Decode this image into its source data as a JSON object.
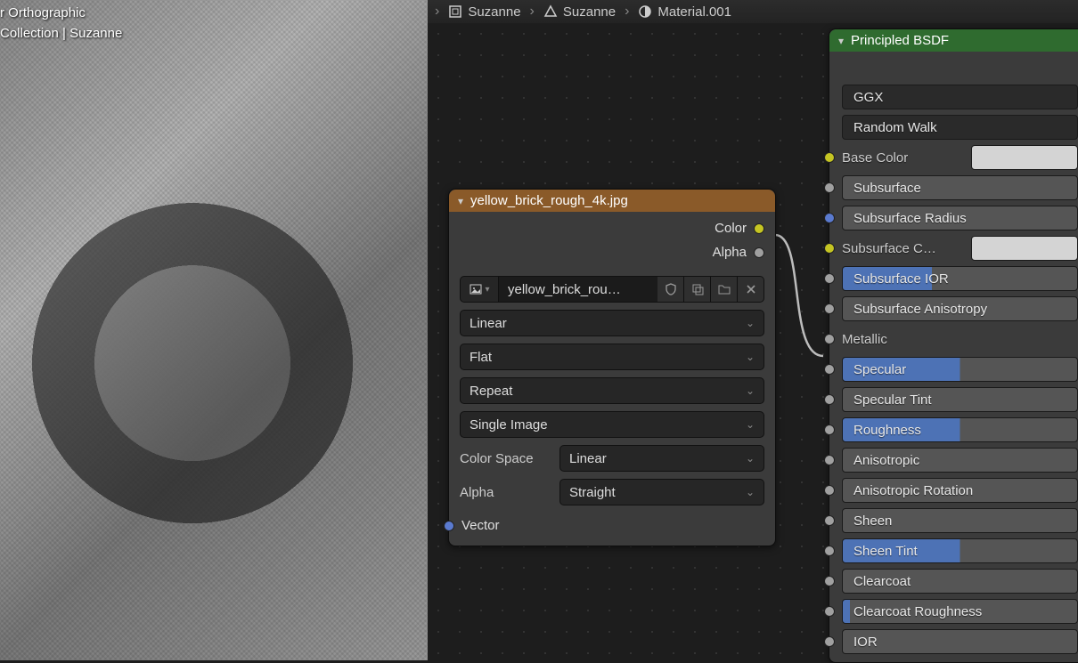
{
  "viewport": {
    "line1": "r Orthographic",
    "line2": "Collection | Suzanne"
  },
  "breadcrumb": {
    "item1": "Suzanne",
    "item2": "Suzanne",
    "item3": "Material.001"
  },
  "imgtex_node": {
    "title": "yellow_brick_rough_4k.jpg",
    "out_color": "Color",
    "out_alpha": "Alpha",
    "image_name": "yellow_brick_rou…",
    "interpolation": "Linear",
    "projection": "Flat",
    "extension": "Repeat",
    "source": "Single Image",
    "colorspace_label": "Color Space",
    "colorspace_value": "Linear",
    "alpha_label": "Alpha",
    "alpha_value": "Straight",
    "in_vector": "Vector"
  },
  "bsdf_node": {
    "title": "Principled BSDF",
    "distribution": "GGX",
    "subsurface_method": "Random Walk",
    "inputs": {
      "base_color": "Base Color",
      "subsurface": "Subsurface",
      "subsurface_radius": "Subsurface Radius",
      "subsurface_color": "Subsurface C…",
      "subsurface_ior": "Subsurface IOR",
      "subsurface_anisotropy": "Subsurface Anisotropy",
      "metallic": "Metallic",
      "specular": "Specular",
      "specular_tint": "Specular Tint",
      "roughness": "Roughness",
      "anisotropic": "Anisotropic",
      "anisotropic_rotation": "Anisotropic Rotation",
      "sheen": "Sheen",
      "sheen_tint": "Sheen Tint",
      "clearcoat": "Clearcoat",
      "clearcoat_roughness": "Clearcoat Roughness",
      "ior": "IOR"
    }
  }
}
